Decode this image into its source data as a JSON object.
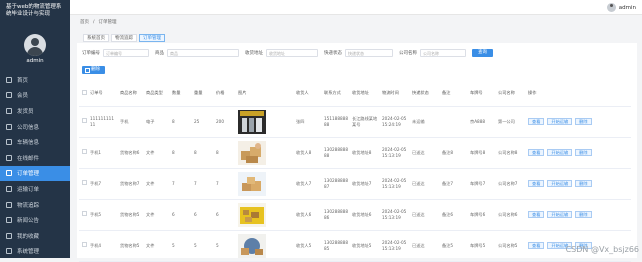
{
  "app": {
    "title": "基于web的物流管理系统毕业设计与实现",
    "username": "admin"
  },
  "sidebar": {
    "items": [
      {
        "label": "首页",
        "icon": "home-icon",
        "active": false
      },
      {
        "label": "会员",
        "icon": "user-icon",
        "active": false
      },
      {
        "label": "发货员",
        "icon": "box-icon",
        "active": false
      },
      {
        "label": "公司信息",
        "icon": "building-icon",
        "active": false
      },
      {
        "label": "车辆信息",
        "icon": "truck-icon",
        "active": false
      },
      {
        "label": "在线邮件",
        "icon": "mail-icon",
        "active": false
      },
      {
        "label": "订单管理",
        "icon": "list-icon",
        "active": true
      },
      {
        "label": "运输订单",
        "icon": "order-icon",
        "active": false
      },
      {
        "label": "物流追踪",
        "icon": "track-icon",
        "active": false
      },
      {
        "label": "新闻公告",
        "icon": "news-icon",
        "active": false
      },
      {
        "label": "我的收藏",
        "icon": "star-icon",
        "active": false
      },
      {
        "label": "系统管理",
        "icon": "settings-icon",
        "active": false
      }
    ]
  },
  "breadcrumb": [
    "首页",
    "订单管理"
  ],
  "tabs": [
    {
      "label": "系统首页",
      "active": false
    },
    {
      "label": "物流追踪",
      "active": false
    },
    {
      "label": "订单管理",
      "active": true
    }
  ],
  "filters": [
    {
      "label": "订单编号",
      "placeholder": "订单编号"
    },
    {
      "label": "商品",
      "placeholder": "商品"
    },
    {
      "label": "收货地址",
      "placeholder": "收货地址"
    },
    {
      "label": "快递状态",
      "placeholder": "快递状态"
    },
    {
      "label": "公司名称",
      "placeholder": "公司名称"
    }
  ],
  "buttons": {
    "search": "查询",
    "delete": "删除"
  },
  "table": {
    "headers": [
      "订单号",
      "商品名称",
      "商品类型",
      "数量",
      "重量",
      "价格",
      "图片",
      "收货人",
      "联系方式",
      "收货地址",
      "物流时间",
      "快递状态",
      "备注",
      "车牌号",
      "公司名称",
      "操作"
    ],
    "rows": [
      [
        "11111111111",
        "手机",
        "电子",
        "8",
        "25",
        "200",
        "",
        "张四",
        "15118888888",
        "长江路线某地某号",
        "2024-02-05 15:24:19",
        "未运输",
        "",
        "京A888",
        "第一公司",
        ""
      ],
      [
        "手机1",
        "货物名称6",
        "文件",
        "8",
        "8",
        "8",
        "",
        "收货人8",
        "13028888888",
        "收货地址8",
        "2024-02-05 15:13:19",
        "已送达",
        "备注8",
        "车牌号8",
        "公司名称8",
        ""
      ],
      [
        "手机7",
        "货物名称7",
        "文件",
        "7",
        "7",
        "7",
        "",
        "收货人7",
        "13028888887",
        "收货地址7",
        "2024-02-05 15:13:19",
        "已送达",
        "备注7",
        "车牌号7",
        "公司名称7",
        ""
      ],
      [
        "手机5",
        "货物名称5",
        "文件",
        "6",
        "6",
        "6",
        "",
        "收货人6",
        "13028888886",
        "收货地址6",
        "2024-02-05 15:13:19",
        "已送达",
        "备注6",
        "车牌号6",
        "公司名称6",
        ""
      ],
      [
        "手机4",
        "货物名称5",
        "文件",
        "5",
        "5",
        "5",
        "",
        "收货人5",
        "13028888885",
        "收货地址5",
        "2024-02-05 15:13:19",
        "已送达",
        "备注5",
        "车牌号5",
        "公司名称5",
        ""
      ]
    ],
    "ops": [
      "查看",
      "开始运输",
      "删除"
    ]
  },
  "watermark": "CSDN @Vx_bsjz66",
  "colors": {
    "sidebar": "#243447",
    "accent": "#3a8ee6",
    "background": "#f3f4f6"
  }
}
